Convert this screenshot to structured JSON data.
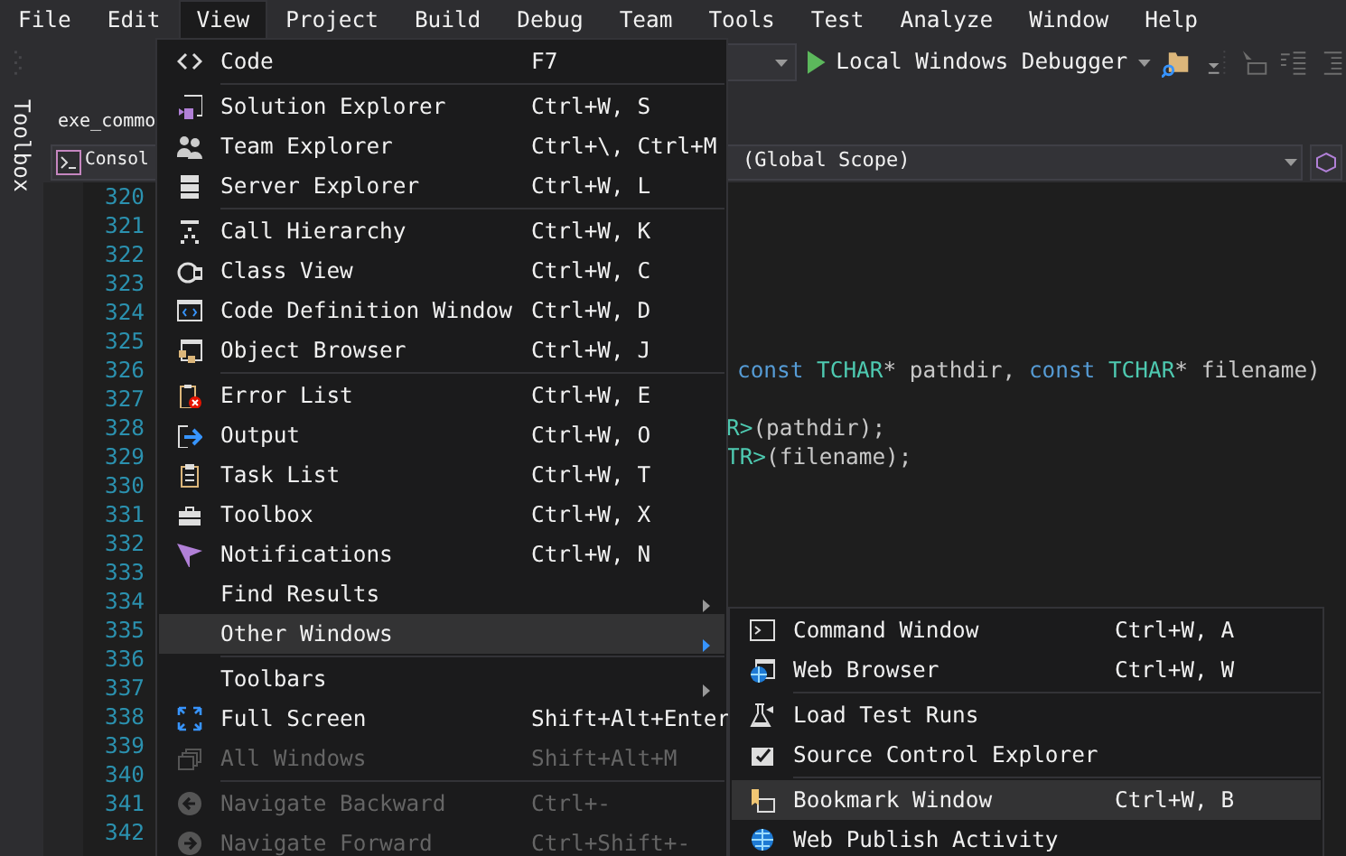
{
  "menubar": [
    {
      "label": "File",
      "selected": false
    },
    {
      "label": "Edit",
      "selected": false
    },
    {
      "label": "View",
      "selected": true
    },
    {
      "label": "Project",
      "selected": false
    },
    {
      "label": "Build",
      "selected": false
    },
    {
      "label": "Debug",
      "selected": false
    },
    {
      "label": "Team",
      "selected": false
    },
    {
      "label": "Tools",
      "selected": false
    },
    {
      "label": "Test",
      "selected": false
    },
    {
      "label": "Analyze",
      "selected": false
    },
    {
      "label": "Window",
      "selected": false
    },
    {
      "label": "Help",
      "selected": false
    }
  ],
  "toolbar": {
    "debugger": "Local Windows Debugger"
  },
  "toolbox_tab": "Toolbox",
  "document_tab": "exe_commo",
  "navigation": {
    "project": "Consol",
    "scope": "(Global Scope)"
  },
  "editor": {
    "lines": [
      {
        "number": "320"
      },
      {
        "number": "321"
      },
      {
        "number": "322"
      },
      {
        "number": "323"
      },
      {
        "number": "324"
      },
      {
        "number": "325"
      },
      {
        "number": "326",
        "tokens": [
          {
            "text": "const ",
            "kind": "keyword"
          },
          {
            "text": "TCHAR",
            "kind": "type"
          },
          {
            "text": "* pathdir, ",
            "kind": "plain"
          },
          {
            "text": "const ",
            "kind": "keyword"
          },
          {
            "text": "TCHAR",
            "kind": "type"
          },
          {
            "text": "* filename)",
            "kind": "plain"
          }
        ]
      },
      {
        "number": "327"
      },
      {
        "number": "328",
        "tokens": [
          {
            "text": "R>",
            "kind": "type"
          },
          {
            "text": "(pathdir);",
            "kind": "plain"
          }
        ]
      },
      {
        "number": "329",
        "tokens": [
          {
            "text": "TR>",
            "kind": "type"
          },
          {
            "text": "(filename);",
            "kind": "plain"
          }
        ]
      },
      {
        "number": "330"
      },
      {
        "number": "331"
      },
      {
        "number": "332"
      },
      {
        "number": "333"
      },
      {
        "number": "334"
      },
      {
        "number": "335"
      },
      {
        "number": "336"
      },
      {
        "number": "337"
      },
      {
        "number": "338"
      },
      {
        "number": "339"
      },
      {
        "number": "340"
      },
      {
        "number": "341"
      },
      {
        "number": "342"
      }
    ]
  },
  "menu": {
    "items": [
      {
        "kind": "item",
        "label": "Code",
        "shortcut": "F7",
        "disabled": false,
        "selected": false
      },
      {
        "kind": "separator"
      },
      {
        "kind": "item",
        "label": "Solution Explorer",
        "shortcut": "Ctrl+W, S",
        "disabled": false,
        "selected": false
      },
      {
        "kind": "item",
        "label": "Team Explorer",
        "shortcut": "Ctrl+\\, Ctrl+M",
        "disabled": false,
        "selected": false
      },
      {
        "kind": "item",
        "label": "Server Explorer",
        "shortcut": "Ctrl+W, L",
        "disabled": false,
        "selected": false
      },
      {
        "kind": "separator"
      },
      {
        "kind": "item",
        "label": "Call Hierarchy",
        "shortcut": "Ctrl+W, K",
        "disabled": false,
        "selected": false
      },
      {
        "kind": "item",
        "label": "Class View",
        "shortcut": "Ctrl+W, C",
        "disabled": false,
        "selected": false
      },
      {
        "kind": "item",
        "label": "Code Definition Window",
        "shortcut": "Ctrl+W, D",
        "disabled": false,
        "selected": false
      },
      {
        "kind": "item",
        "label": "Object Browser",
        "shortcut": "Ctrl+W, J",
        "disabled": false,
        "selected": false
      },
      {
        "kind": "separator"
      },
      {
        "kind": "item",
        "label": "Error List",
        "shortcut": "Ctrl+W, E",
        "disabled": false,
        "selected": false
      },
      {
        "kind": "item",
        "label": "Output",
        "shortcut": "Ctrl+W, O",
        "disabled": false,
        "selected": false
      },
      {
        "kind": "item",
        "label": "Task List",
        "shortcut": "Ctrl+W, T",
        "disabled": false,
        "selected": false
      },
      {
        "kind": "item",
        "label": "Toolbox",
        "shortcut": "Ctrl+W, X",
        "disabled": false,
        "selected": false
      },
      {
        "kind": "item",
        "label": "Notifications",
        "shortcut": "Ctrl+W, N",
        "disabled": false,
        "selected": false
      },
      {
        "kind": "submenu",
        "label": "Find Results",
        "disabled": false,
        "selected": false
      },
      {
        "kind": "submenu",
        "label": "Other Windows",
        "disabled": false,
        "selected": true
      },
      {
        "kind": "separator"
      },
      {
        "kind": "submenu",
        "label": "Toolbars",
        "disabled": false,
        "selected": false
      },
      {
        "kind": "item",
        "label": "Full Screen",
        "shortcut": "Shift+Alt+Enter",
        "disabled": false,
        "selected": false
      },
      {
        "kind": "item",
        "label": "All Windows",
        "shortcut": "Shift+Alt+M",
        "disabled": true,
        "selected": false
      },
      {
        "kind": "separator"
      },
      {
        "kind": "item",
        "label": "Navigate Backward",
        "shortcut": "Ctrl+-",
        "disabled": true,
        "selected": false
      },
      {
        "kind": "item",
        "label": "Navigate Forward",
        "shortcut": "Ctrl+Shift+-",
        "disabled": true,
        "selected": false
      }
    ]
  },
  "submenu": {
    "items": [
      {
        "kind": "item",
        "label": "Command Window",
        "shortcut": "Ctrl+W, A",
        "disabled": false,
        "selected": false
      },
      {
        "kind": "item",
        "label": "Web Browser",
        "shortcut": "Ctrl+W, W",
        "disabled": false,
        "selected": false
      },
      {
        "kind": "separator"
      },
      {
        "kind": "item",
        "label": "Load Test Runs",
        "disabled": false,
        "selected": false
      },
      {
        "kind": "item",
        "label": "Source Control Explorer",
        "disabled": false,
        "selected": false
      },
      {
        "kind": "separator"
      },
      {
        "kind": "item",
        "label": "Bookmark Window",
        "shortcut": "Ctrl+W, B",
        "disabled": false,
        "selected": true
      },
      {
        "kind": "item",
        "label": "Web Publish Activity",
        "disabled": false,
        "selected": false
      }
    ]
  }
}
